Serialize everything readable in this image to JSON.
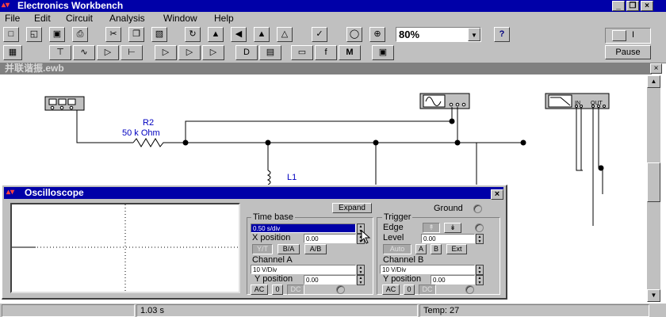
{
  "app": {
    "title": "Electronics Workbench"
  },
  "menu": [
    "File",
    "Edit",
    "Circuit",
    "Analysis",
    "Window",
    "Help"
  ],
  "toolbar": {
    "zoom": "80%",
    "help": "?",
    "pause": "Pause",
    "power_label": "I"
  },
  "document": {
    "title": "并联谐振.ewb"
  },
  "schematic": {
    "r2_name": "R2",
    "r2_value": "50 k Ohm",
    "l1_name": "L1",
    "bode_in": "IN",
    "bode_out": "OUT"
  },
  "oscilloscope": {
    "title": "Oscilloscope",
    "expand": "Expand",
    "ground": "Ground",
    "timebase": {
      "label": "Time base",
      "value": "0.50 s/div",
      "xpos_label": "X position",
      "xpos": "0.00",
      "modes": [
        "Y/T",
        "B/A",
        "A/B"
      ]
    },
    "trigger": {
      "label": "Trigger",
      "edge_label": "Edge",
      "level_label": "Level",
      "level": "0.00",
      "sources": [
        "Auto",
        "A",
        "B",
        "Ext"
      ]
    },
    "channel_a": {
      "label": "Channel A",
      "value": "10 V/Div",
      "ypos_label": "Y position",
      "ypos": "0.00",
      "coupling": [
        "AC",
        "0",
        "DC"
      ]
    },
    "channel_b": {
      "label": "Channel B",
      "value": "10 V/Div",
      "ypos_label": "Y position",
      "ypos": "0.00",
      "coupling": [
        "AC",
        "0",
        "DC"
      ]
    }
  },
  "status": {
    "time": "1.03 s",
    "temp": "Temp:  27"
  }
}
